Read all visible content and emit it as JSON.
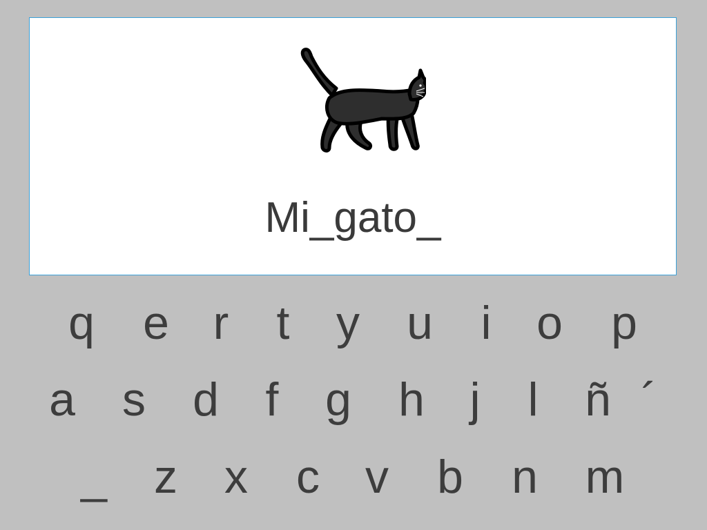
{
  "phrase": "Mi_gato_",
  "image": {
    "icon": "black-cat-icon",
    "color": "#2e2e2e"
  },
  "keyboard": {
    "row1": [
      "q",
      "e",
      "r",
      "t",
      "y",
      "u",
      "i",
      "o",
      "p"
    ],
    "row2": [
      "a",
      "s",
      "d",
      "f",
      "g",
      "h",
      "j",
      "l",
      "ñ",
      "´"
    ],
    "row3": [
      "_",
      "z",
      "x",
      "c",
      "v",
      "b",
      "n",
      "m"
    ]
  },
  "colors": {
    "background": "#c0c0c0",
    "card": "#ffffff",
    "card_border": "#3aa0d8",
    "text": "#3d3d3d"
  }
}
